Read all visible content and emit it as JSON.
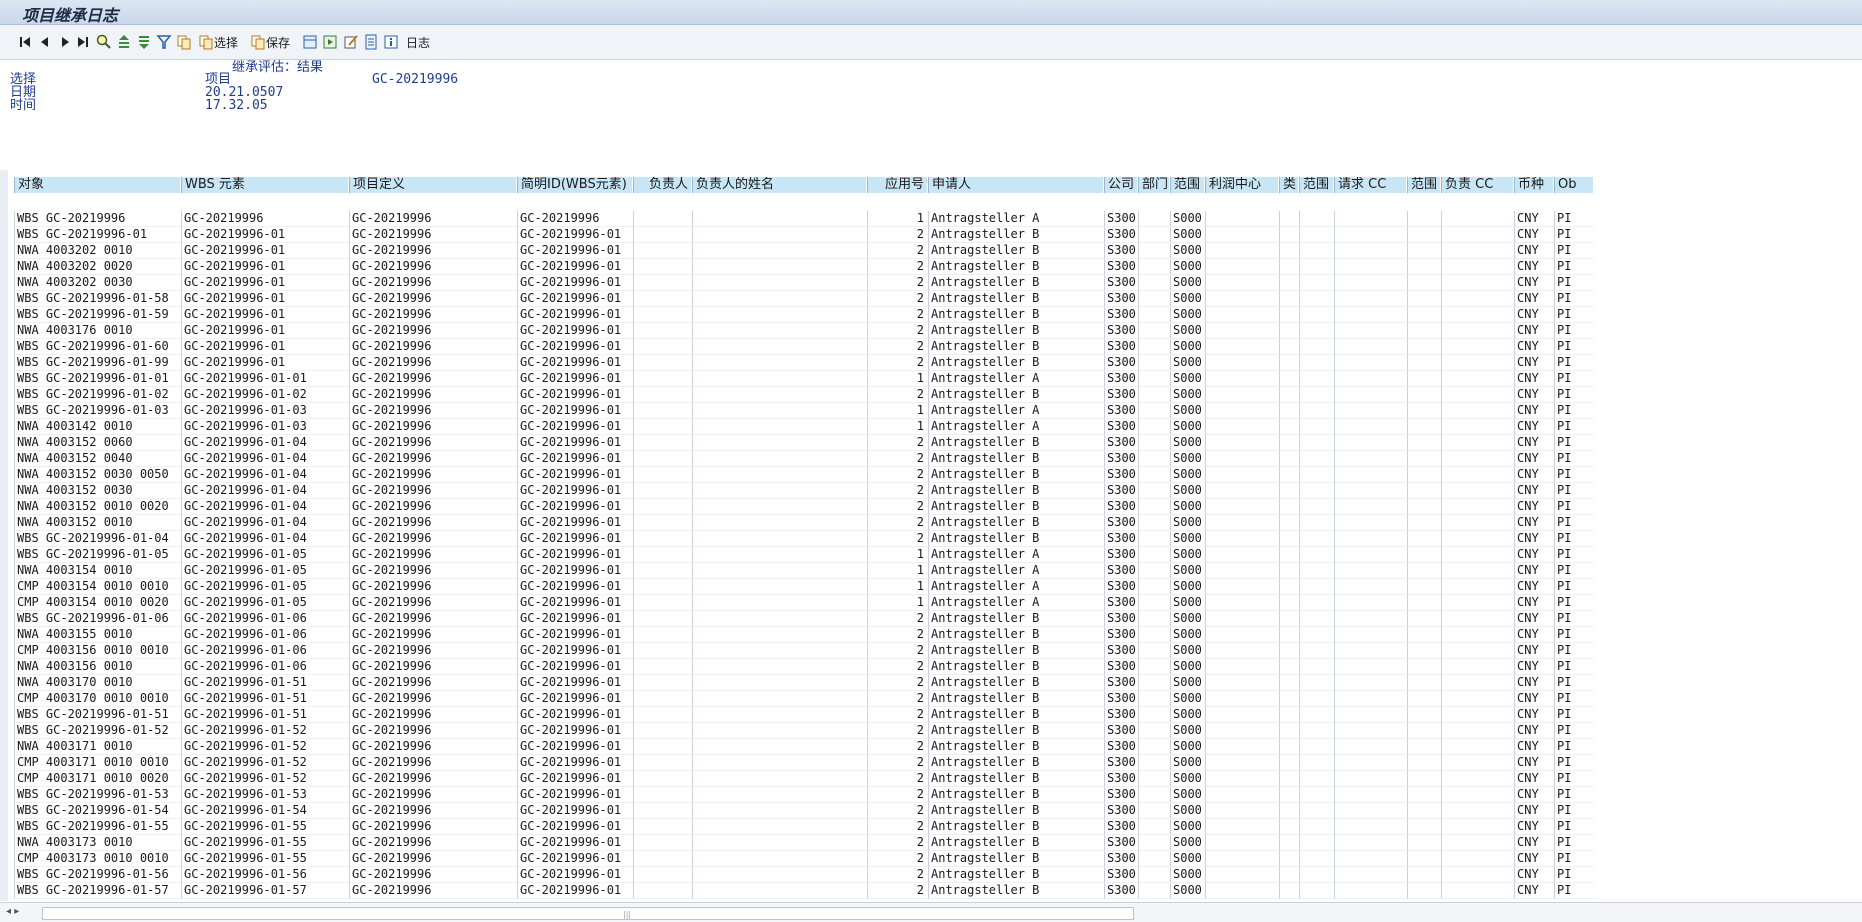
{
  "window": {
    "title": "项目继承日志"
  },
  "toolbar": {
    "select_label": "选择",
    "save_label": "保存",
    "log_label": "日志"
  },
  "header": {
    "subtitle": "继承评估：结果",
    "label_select": "选择",
    "label_date": "日期",
    "label_time": "时间",
    "select_value": "项目",
    "project_value": "GC-20219996",
    "date_value": "20.21.0507",
    "time_value": "17.32.05"
  },
  "columns": [
    "对象",
    "WBS 元素",
    "项目定义",
    "简明ID(WBS元素)",
    "负责人",
    "负责人的姓名",
    "应用号",
    "申请人",
    "公司",
    "部门",
    "范围",
    "利润中心",
    "类",
    "范围",
    "请求 CC",
    "范围",
    "负责 CC",
    "币种",
    "Ob"
  ],
  "rows": [
    [
      "WBS GC-20219996",
      "GC-20219996",
      "GC-20219996",
      "GC-20219996",
      "1",
      "Antragsteller A"
    ],
    [
      "WBS GC-20219996-01",
      "GC-20219996-01",
      "GC-20219996",
      "GC-20219996-01",
      "2",
      "Antragsteller B"
    ],
    [
      "NWA 4003202 0010",
      "GC-20219996-01",
      "GC-20219996",
      "GC-20219996-01",
      "2",
      "Antragsteller B"
    ],
    [
      "NWA 4003202 0020",
      "GC-20219996-01",
      "GC-20219996",
      "GC-20219996-01",
      "2",
      "Antragsteller B"
    ],
    [
      "NWA 4003202 0030",
      "GC-20219996-01",
      "GC-20219996",
      "GC-20219996-01",
      "2",
      "Antragsteller B"
    ],
    [
      "WBS GC-20219996-01-58",
      "GC-20219996-01",
      "GC-20219996",
      "GC-20219996-01",
      "2",
      "Antragsteller B"
    ],
    [
      "WBS GC-20219996-01-59",
      "GC-20219996-01",
      "GC-20219996",
      "GC-20219996-01",
      "2",
      "Antragsteller B"
    ],
    [
      "NWA 4003176 0010",
      "GC-20219996-01",
      "GC-20219996",
      "GC-20219996-01",
      "2",
      "Antragsteller B"
    ],
    [
      "WBS GC-20219996-01-60",
      "GC-20219996-01",
      "GC-20219996",
      "GC-20219996-01",
      "2",
      "Antragsteller B"
    ],
    [
      "WBS GC-20219996-01-99",
      "GC-20219996-01",
      "GC-20219996",
      "GC-20219996-01",
      "2",
      "Antragsteller B"
    ],
    [
      "WBS GC-20219996-01-01",
      "GC-20219996-01-01",
      "GC-20219996",
      "GC-20219996-01",
      "1",
      "Antragsteller A"
    ],
    [
      "WBS GC-20219996-01-02",
      "GC-20219996-01-02",
      "GC-20219996",
      "GC-20219996-01",
      "2",
      "Antragsteller B"
    ],
    [
      "WBS GC-20219996-01-03",
      "GC-20219996-01-03",
      "GC-20219996",
      "GC-20219996-01",
      "1",
      "Antragsteller A"
    ],
    [
      "NWA 4003142 0010",
      "GC-20219996-01-03",
      "GC-20219996",
      "GC-20219996-01",
      "1",
      "Antragsteller A"
    ],
    [
      "NWA 4003152 0060",
      "GC-20219996-01-04",
      "GC-20219996",
      "GC-20219996-01",
      "2",
      "Antragsteller B"
    ],
    [
      "NWA 4003152 0040",
      "GC-20219996-01-04",
      "GC-20219996",
      "GC-20219996-01",
      "2",
      "Antragsteller B"
    ],
    [
      "NWA 4003152 0030 0050",
      "GC-20219996-01-04",
      "GC-20219996",
      "GC-20219996-01",
      "2",
      "Antragsteller B"
    ],
    [
      "NWA 4003152 0030",
      "GC-20219996-01-04",
      "GC-20219996",
      "GC-20219996-01",
      "2",
      "Antragsteller B"
    ],
    [
      "NWA 4003152 0010 0020",
      "GC-20219996-01-04",
      "GC-20219996",
      "GC-20219996-01",
      "2",
      "Antragsteller B"
    ],
    [
      "NWA 4003152 0010",
      "GC-20219996-01-04",
      "GC-20219996",
      "GC-20219996-01",
      "2",
      "Antragsteller B"
    ],
    [
      "WBS GC-20219996-01-04",
      "GC-20219996-01-04",
      "GC-20219996",
      "GC-20219996-01",
      "2",
      "Antragsteller B"
    ],
    [
      "WBS GC-20219996-01-05",
      "GC-20219996-01-05",
      "GC-20219996",
      "GC-20219996-01",
      "1",
      "Antragsteller A"
    ],
    [
      "NWA 4003154 0010",
      "GC-20219996-01-05",
      "GC-20219996",
      "GC-20219996-01",
      "1",
      "Antragsteller A"
    ],
    [
      "CMP 4003154 0010  0010",
      "GC-20219996-01-05",
      "GC-20219996",
      "GC-20219996-01",
      "1",
      "Antragsteller A"
    ],
    [
      "CMP 4003154 0010  0020",
      "GC-20219996-01-05",
      "GC-20219996",
      "GC-20219996-01",
      "1",
      "Antragsteller A"
    ],
    [
      "WBS GC-20219996-01-06",
      "GC-20219996-01-06",
      "GC-20219996",
      "GC-20219996-01",
      "2",
      "Antragsteller B"
    ],
    [
      "NWA 4003155 0010",
      "GC-20219996-01-06",
      "GC-20219996",
      "GC-20219996-01",
      "2",
      "Antragsteller B"
    ],
    [
      "CMP 4003156 0010  0010",
      "GC-20219996-01-06",
      "GC-20219996",
      "GC-20219996-01",
      "2",
      "Antragsteller B"
    ],
    [
      "NWA 4003156 0010",
      "GC-20219996-01-06",
      "GC-20219996",
      "GC-20219996-01",
      "2",
      "Antragsteller B"
    ],
    [
      "NWA 4003170 0010",
      "GC-20219996-01-51",
      "GC-20219996",
      "GC-20219996-01",
      "2",
      "Antragsteller B"
    ],
    [
      "CMP 4003170 0010  0010",
      "GC-20219996-01-51",
      "GC-20219996",
      "GC-20219996-01",
      "2",
      "Antragsteller B"
    ],
    [
      "WBS GC-20219996-01-51",
      "GC-20219996-01-51",
      "GC-20219996",
      "GC-20219996-01",
      "2",
      "Antragsteller B"
    ],
    [
      "WBS GC-20219996-01-52",
      "GC-20219996-01-52",
      "GC-20219996",
      "GC-20219996-01",
      "2",
      "Antragsteller B"
    ],
    [
      "NWA 4003171 0010",
      "GC-20219996-01-52",
      "GC-20219996",
      "GC-20219996-01",
      "2",
      "Antragsteller B"
    ],
    [
      "CMP 4003171 0010  0010",
      "GC-20219996-01-52",
      "GC-20219996",
      "GC-20219996-01",
      "2",
      "Antragsteller B"
    ],
    [
      "CMP 4003171 0010  0020",
      "GC-20219996-01-52",
      "GC-20219996",
      "GC-20219996-01",
      "2",
      "Antragsteller B"
    ],
    [
      "WBS GC-20219996-01-53",
      "GC-20219996-01-53",
      "GC-20219996",
      "GC-20219996-01",
      "2",
      "Antragsteller B"
    ],
    [
      "WBS GC-20219996-01-54",
      "GC-20219996-01-54",
      "GC-20219996",
      "GC-20219996-01",
      "2",
      "Antragsteller B"
    ],
    [
      "WBS GC-20219996-01-55",
      "GC-20219996-01-55",
      "GC-20219996",
      "GC-20219996-01",
      "2",
      "Antragsteller B"
    ],
    [
      "NWA 4003173 0010",
      "GC-20219996-01-55",
      "GC-20219996",
      "GC-20219996-01",
      "2",
      "Antragsteller B"
    ],
    [
      "CMP 4003173 0010  0010",
      "GC-20219996-01-55",
      "GC-20219996",
      "GC-20219996-01",
      "2",
      "Antragsteller B"
    ],
    [
      "WBS GC-20219996-01-56",
      "GC-20219996-01-56",
      "GC-20219996",
      "GC-20219996-01",
      "2",
      "Antragsteller B"
    ],
    [
      "WBS GC-20219996-01-57",
      "GC-20219996-01-57",
      "GC-20219996",
      "GC-20219996-01",
      "2",
      "Antragsteller B"
    ]
  ],
  "row_defaults": {
    "company": "S300",
    "scope": "S000",
    "currency": "CNY",
    "ob": "PI"
  }
}
